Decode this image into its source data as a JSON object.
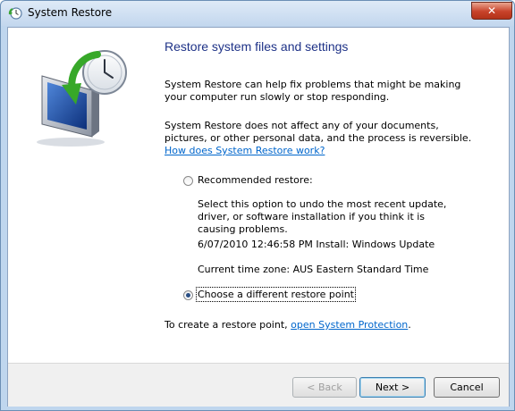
{
  "window": {
    "title": "System Restore",
    "close_label": "✕"
  },
  "main": {
    "heading": "Restore system files and settings",
    "intro": "System Restore can help fix problems that might be making your computer run slowly or stop responding.",
    "info_text": "System Restore does not affect any of your documents, pictures, or other personal data, and the process is reversible. ",
    "info_link": "How does System Restore work?",
    "recommended": {
      "label": "Recommended restore:",
      "selected": false,
      "description": "Select this option to undo the most recent update, driver, or software installation if you think it is causing problems.",
      "restore_point": "6/07/2010 12:46:58 PM Install: Windows Update",
      "timezone": "Current time zone: AUS Eastern Standard Time"
    },
    "different": {
      "label": "Choose a different restore point",
      "selected": true
    },
    "create_text": "To create a restore point, ",
    "create_link": "open System Protection",
    "create_suffix": "."
  },
  "footer": {
    "back_label": "< Back",
    "next_label": "Next >",
    "cancel_label": "Cancel"
  },
  "colors": {
    "heading": "#1e3287",
    "link": "#0066cc"
  }
}
